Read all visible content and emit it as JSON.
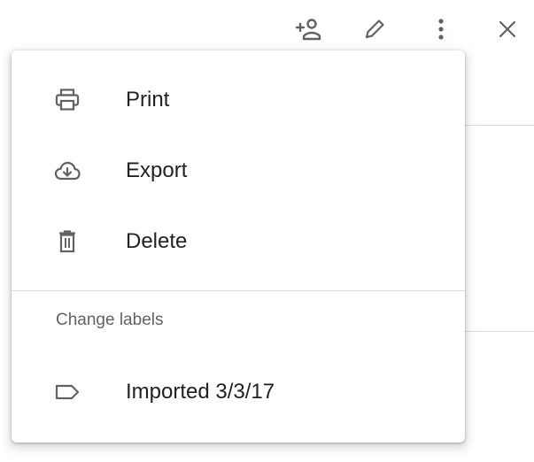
{
  "toolbar": {
    "buttons": [
      {
        "name": "add-person",
        "icon": "person-add-icon"
      },
      {
        "name": "edit",
        "icon": "pencil-icon"
      },
      {
        "name": "more",
        "icon": "more-vert-icon"
      },
      {
        "name": "close",
        "icon": "close-icon"
      }
    ]
  },
  "menu": {
    "items": [
      {
        "label": "Print",
        "icon": "printer-icon"
      },
      {
        "label": "Export",
        "icon": "cloud-download-icon"
      },
      {
        "label": "Delete",
        "icon": "trash-icon"
      }
    ],
    "section_label": "Change labels",
    "labels": [
      {
        "label": "Imported 3/3/17",
        "icon": "label-tag-icon"
      }
    ]
  },
  "colors": {
    "text_primary": "#202124",
    "text_secondary": "#5f6368",
    "icon": "#5f6368",
    "divider": "#dadce0"
  }
}
